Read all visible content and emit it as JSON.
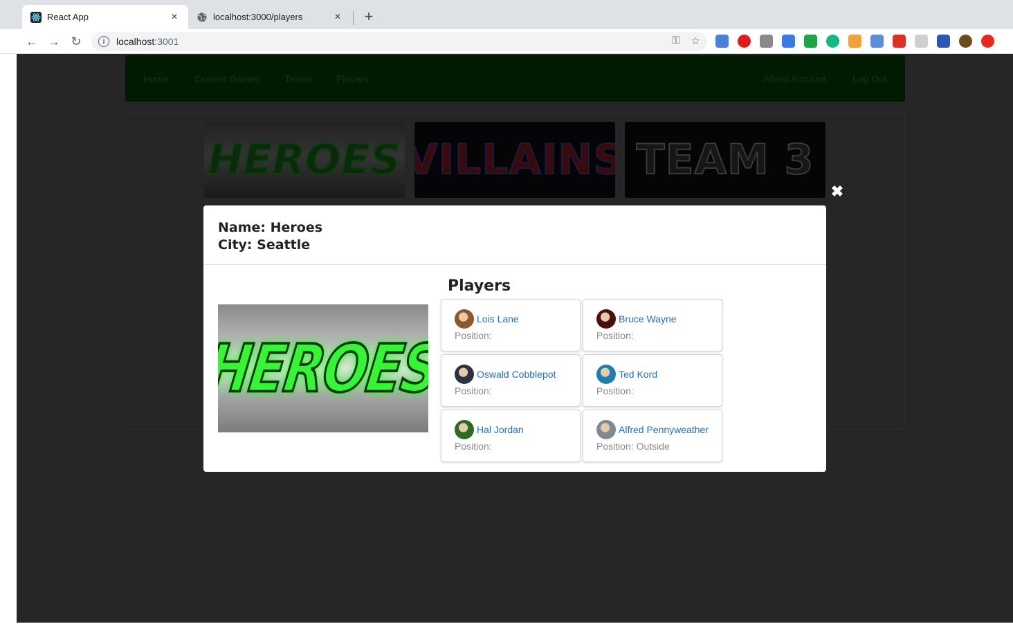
{
  "browser": {
    "tabs": [
      {
        "label": "React App",
        "close": "×"
      },
      {
        "label": "localhost:3000/players",
        "close": "×"
      }
    ],
    "new_tab": "+",
    "nav": {
      "back": "←",
      "forward": "→",
      "reload": "↻"
    },
    "url": {
      "host": "localhost",
      "port": ":3001"
    },
    "omnibox_icons": {
      "key": "⚿",
      "star": "☆"
    },
    "extension_colors": [
      "#4e7fd6",
      "#e01c1c",
      "#8a8a8a",
      "#3b7be6",
      "#20a545",
      "#13b884",
      "#f0a23a",
      "#5d8fd8",
      "#d9322b",
      "#cfcfcf",
      "#3056b5",
      "#6b4a1b",
      "#e8261c"
    ]
  },
  "app_nav": {
    "left_links": [
      "Home",
      "Current Games",
      "Teams",
      "Players"
    ],
    "right_links": [
      "Alfred Account",
      "Log Out"
    ]
  },
  "team_cards": [
    {
      "text": "HEROES"
    },
    {
      "text": "VILLAINS"
    },
    {
      "text": "TEAM 3"
    }
  ],
  "modal": {
    "close": "✖",
    "name_line": "Name: Heroes",
    "city_line": "City: Seattle",
    "image_text": "HEROES",
    "players_heading": "Players",
    "players": [
      {
        "name": "Lois Lane",
        "position": "Position:",
        "avatar_color": "#8b5a2b"
      },
      {
        "name": "Bruce Wayne",
        "position": "Position:",
        "avatar_color": "#4a1010"
      },
      {
        "name": "Oswald Cobblepot",
        "position": "Position:",
        "avatar_color": "#2b3340"
      },
      {
        "name": "Ted Kord",
        "position": "Position:",
        "avatar_color": "#1d7fb0"
      },
      {
        "name": "Hal Jordan",
        "position": "Position:",
        "avatar_color": "#2d6b22"
      },
      {
        "name": "Alfred Pennyweather",
        "position": "Position: Outside",
        "avatar_color": "#7f8a92"
      }
    ]
  }
}
